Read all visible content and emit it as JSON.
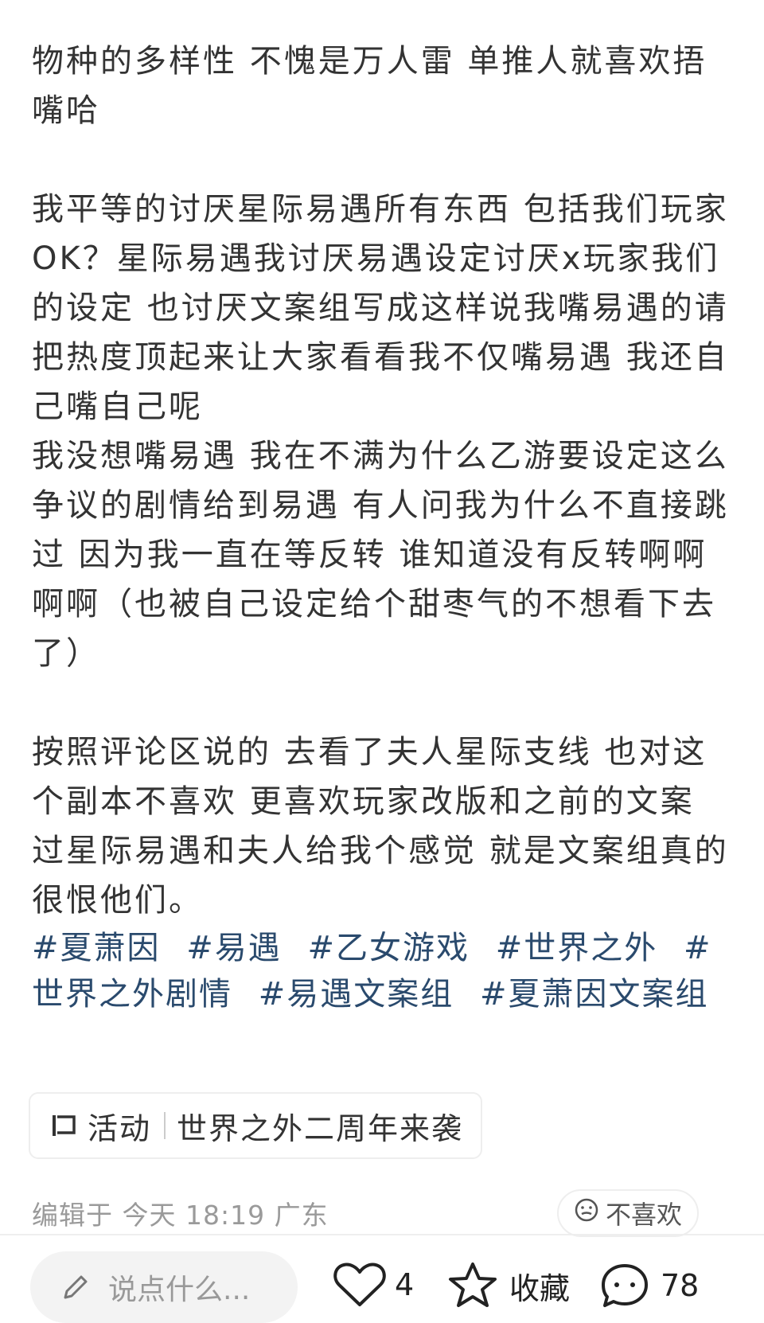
{
  "post": {
    "paragraphs": [
      "物种的多样性 不愧是万人雷 单推人就喜欢捂嘴哈",
      "",
      "我平等的讨厌星际易遇所有东西 包括我们玩家OK？星际易遇我讨厌易遇设定讨厌x玩家我们的设定 也讨厌文案组写成这样说我嘴易遇的请把热度顶起来让大家看看我不仅嘴易遇 我还自己嘴自己呢\n我没想嘴易遇 我在不满为什么乙游要设定这么争议的剧情给到易遇 有人问我为什么不直接跳过 因为我一直在等反转 谁知道没有反转啊啊啊啊（也被自己设定给个甜枣气的不想看下去了）",
      "",
      "按照评论区说的 去看了夫人星际支线 也对这个副本不喜欢 更喜欢玩家改版和之前的文案 过星际易遇和夫人给我个感觉 就是文案组真的很恨他们。"
    ],
    "tags": [
      "#夏萧因",
      "#易遇",
      "#乙女游戏",
      "#世界之外",
      "#世界之外剧情",
      "#易遇文案组",
      "#夏萧因文案组"
    ]
  },
  "activity": {
    "label": "活动",
    "title": "世界之外二周年来袭"
  },
  "meta": {
    "edited": "编辑于 今天 18:19 广东",
    "dislike_label": "不喜欢"
  },
  "bottom_bar": {
    "comment_placeholder": "说点什么...",
    "like_count": "4",
    "favorite_label": "收藏",
    "comment_count": "78"
  },
  "colors": {
    "tag": "#2a4a6d",
    "meta": "#9a9a9a"
  }
}
